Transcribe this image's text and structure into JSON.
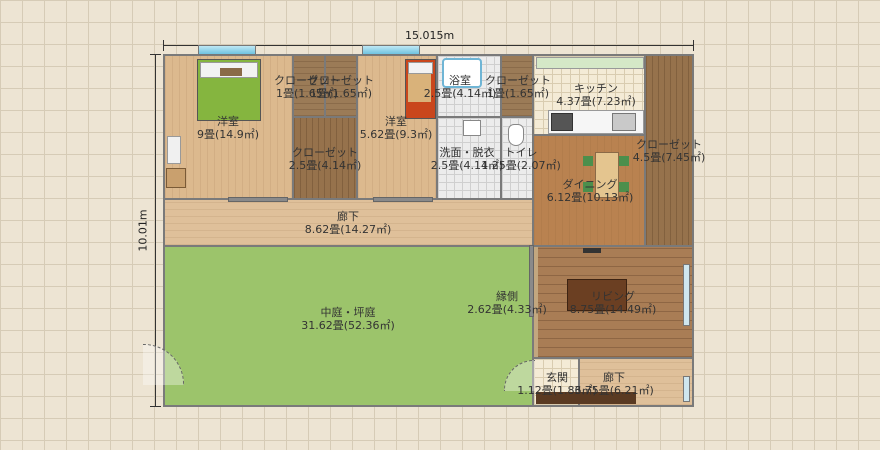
{
  "dimensions": {
    "width": "15.015m",
    "height": "10.01m"
  },
  "rooms": {
    "bedroom1": {
      "name": "洋室",
      "size": "9畳(14.9㎡)"
    },
    "closet1": {
      "name": "クローゼット",
      "size": "1畳(1.65㎡)"
    },
    "closet2": {
      "name": "クローゼット",
      "size": "1畳(1.65㎡)"
    },
    "closet_mid": {
      "name": "クローゼット",
      "size": "2.5畳(4.14㎡)"
    },
    "bedroom2": {
      "name": "洋室",
      "size": "5.62畳(9.3㎡)"
    },
    "bath": {
      "name": "浴室",
      "size": "2.5畳(4.14㎡)"
    },
    "closet3": {
      "name": "クローゼット",
      "size": "1畳(1.65㎡)"
    },
    "kitchen": {
      "name": "キッチン",
      "size": "4.37畳(7.23㎡)"
    },
    "washroom": {
      "name": "洗面・脱衣",
      "size": "2.5畳(4.14㎡)"
    },
    "toilet": {
      "name": "トイレ",
      "size": "1.25畳(2.07㎡)"
    },
    "closet_right": {
      "name": "クローゼット",
      "size": "4.5畳(7.45㎡)"
    },
    "dining": {
      "name": "ダイニング",
      "size": "6.12畳(10.13㎡)"
    },
    "hallway": {
      "name": "廊下",
      "size": "8.62畳(14.27㎡)"
    },
    "courtyard": {
      "name": "中庭・坪庭",
      "size": "31.62畳(52.36㎡)"
    },
    "engawa": {
      "name": "縁側",
      "size": "2.62畳(4.33㎡)"
    },
    "living": {
      "name": "リビング",
      "size": "8.75畳(14.49㎡)"
    },
    "entrance": {
      "name": "玄関",
      "size": "1.12畳(1.86㎡)"
    },
    "hallway2": {
      "name": "廊下",
      "size": "3.75畳(6.21㎡)"
    }
  },
  "colors": {
    "floor_wood": "#dcb98e",
    "closet_wood": "#96724c",
    "grass": "#9cc46b",
    "wall": "#7a7a7a"
  }
}
